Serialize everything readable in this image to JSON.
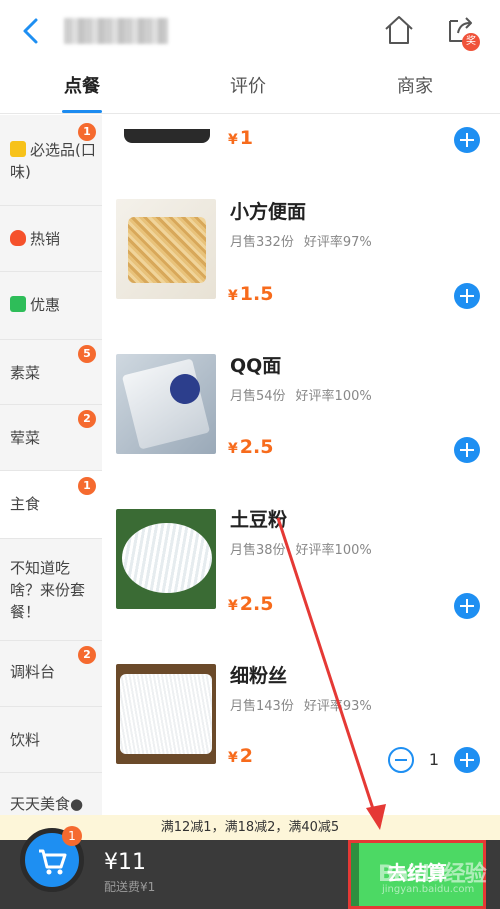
{
  "tabs": [
    {
      "label": "点餐"
    },
    {
      "label": "评价"
    },
    {
      "label": "商家"
    }
  ],
  "header": {
    "share_badge": "奖"
  },
  "categories": [
    {
      "label": "必选品(口味)",
      "badge": "1",
      "icon": "star-icon"
    },
    {
      "label": "热销",
      "badge": "",
      "icon": "fire-icon"
    },
    {
      "label": "优惠",
      "badge": "",
      "icon": "discount-icon"
    },
    {
      "label": "素菜",
      "badge": "5"
    },
    {
      "label": "荤菜",
      "badge": "2"
    },
    {
      "label": "主食",
      "badge": "1"
    },
    {
      "label": "不知道吃啥？来份套餐！",
      "badge": ""
    },
    {
      "label": "调料台",
      "badge": "2"
    },
    {
      "label": "饮料",
      "badge": ""
    },
    {
      "label": "天天美食●",
      "badge": ""
    }
  ],
  "products": [
    {
      "name": "",
      "sold": "",
      "rating": "",
      "price": "1"
    },
    {
      "name": "小方便面",
      "sold": "月售332份",
      "rating": "好评率97%",
      "price": "1.5"
    },
    {
      "name": "QQ面",
      "sold": "月售54份",
      "rating": "好评率100%",
      "price": "2.5"
    },
    {
      "name": "土豆粉",
      "sold": "月售38份",
      "rating": "好评率100%",
      "price": "2.5"
    },
    {
      "name": "细粉丝",
      "sold": "月售143份",
      "rating": "好评率93%",
      "price": "2",
      "qty": "1"
    }
  ],
  "currency": "¥",
  "promo": "满12减1，满18减2，满40减5",
  "cart": {
    "badge": "1",
    "total": "¥11",
    "delivery": "配送费¥1",
    "checkout": "去结算"
  },
  "watermark": {
    "main": "Baidu经验",
    "sub": "jingyan.baidu.com"
  },
  "colors": {
    "accent": "#1e8ff2",
    "price": "#f76b1c",
    "badge": "#f56a2f",
    "checkout": "#4cd964"
  }
}
